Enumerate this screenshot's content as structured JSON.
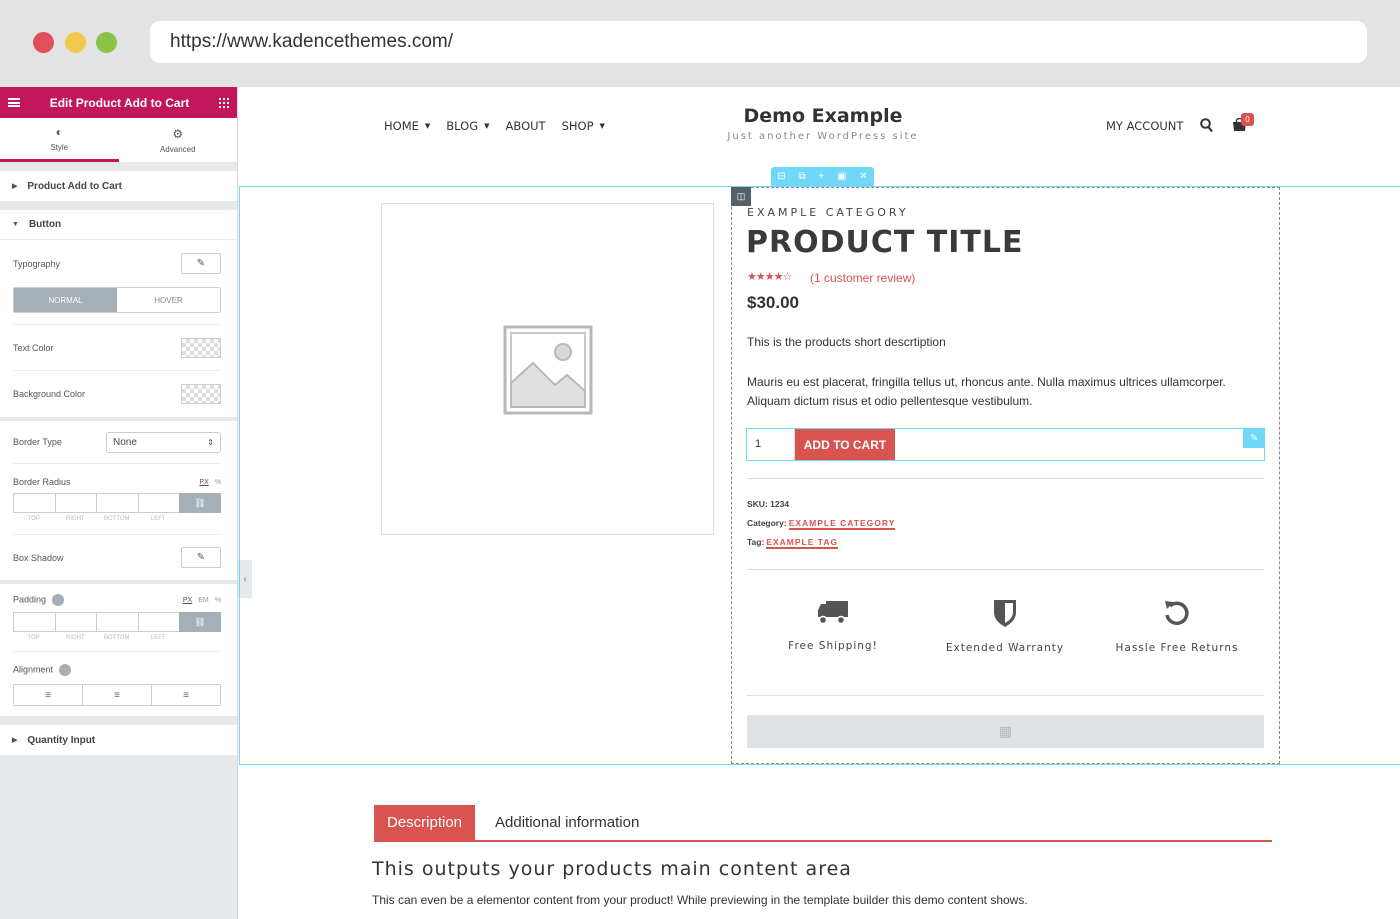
{
  "browser": {
    "url": "https://www.kadencethemes.com/"
  },
  "panel": {
    "title": "Edit Product Add to Cart",
    "tabs": [
      {
        "label": "Style"
      },
      {
        "label": "Advanced"
      }
    ],
    "sections": {
      "product_add_to_cart": "Product Add to Cart",
      "button": "Button",
      "quantity_input": "Quantity Input"
    },
    "controls": {
      "typography": "Typography",
      "normal": "NORMAL",
      "hover": "HOVER",
      "text_color": "Text Color",
      "background_color": "Background Color",
      "border_type": "Border Type",
      "border_type_value": "None",
      "border_radius": "Border Radius",
      "box_shadow": "Box Shadow",
      "padding": "Padding",
      "alignment": "Alignment",
      "units_px": "PX",
      "units_em": "EM",
      "units_pct": "%",
      "dims": [
        "TOP",
        "RIGHT",
        "BOTTOM",
        "LEFT"
      ]
    }
  },
  "site": {
    "nav": [
      {
        "label": "HOME",
        "dropdown": true
      },
      {
        "label": "BLOG",
        "dropdown": true
      },
      {
        "label": "ABOUT",
        "dropdown": false
      },
      {
        "label": "SHOP",
        "dropdown": true
      }
    ],
    "title": "Demo Example",
    "tagline": "Just another WordPress site",
    "account": "MY ACCOUNT",
    "cart_count": "0"
  },
  "product": {
    "category": "EXAMPLE CATEGORY",
    "title": "PRODUCT TITLE",
    "rating": 4.5,
    "stars": "★★★★☆",
    "review_link": "(1 customer review)",
    "price": "$30.00",
    "short_description": "This is the products short descrtiption",
    "long_description": "Mauris eu est placerat, fringilla tellus ut, rhoncus ante. Nulla maximus ultrices ullamcorper. Aliquam dictum risus et odio pellentesque vestibulum.",
    "quantity": "1",
    "add_to_cart": "ADD TO CART",
    "sku_label": "SKU:",
    "sku": "1234",
    "category_label": "Category:",
    "category_link": "EXAMPLE CATEGORY",
    "tag_label": "Tag:",
    "tag_link": "EXAMPLE TAG",
    "features": [
      {
        "label": "Free Shipping!",
        "icon": "truck-icon"
      },
      {
        "label": "Extended Warranty",
        "icon": "shield-icon"
      },
      {
        "label": "Hassle Free Returns",
        "icon": "undo-icon"
      }
    ]
  },
  "tabs": {
    "items": [
      {
        "label": "Description"
      },
      {
        "label": "Additional information"
      }
    ],
    "heading": "This outputs your products main content area",
    "text": "This can even be a elementor content from your product! While previewing in the template builder this demo content shows."
  },
  "colors": {
    "brand": "#c2185b",
    "accent": "#d9534f",
    "editor_blue": "#71d7f7"
  }
}
